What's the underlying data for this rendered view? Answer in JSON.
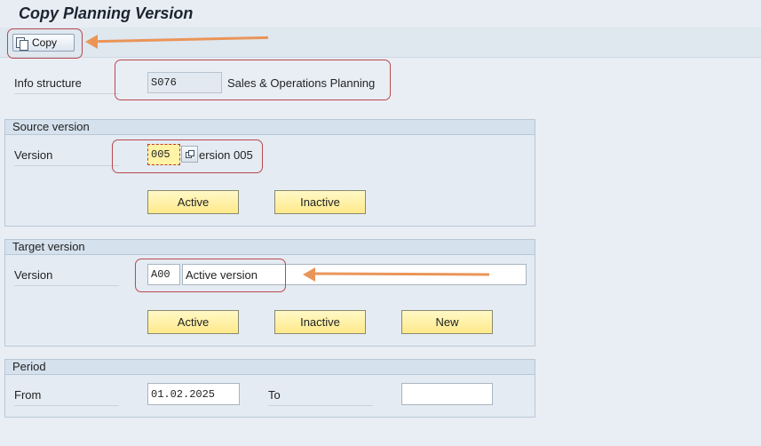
{
  "window": {
    "title": "Copy Planning Version"
  },
  "toolbar": {
    "copy_label": "Copy"
  },
  "info_structure": {
    "label": "Info structure",
    "value": "S076",
    "description": "Sales & Operations Planning"
  },
  "source_version": {
    "group_title": "Source version",
    "label": "Version",
    "value": "005",
    "description": "ersion 005",
    "buttons": {
      "active": "Active",
      "inactive": "Inactive"
    }
  },
  "target_version": {
    "group_title": "Target version",
    "label": "Version",
    "value": "A00",
    "description": "Active version",
    "buttons": {
      "active": "Active",
      "inactive": "Inactive",
      "new": "New"
    }
  },
  "period": {
    "group_title": "Period",
    "from_label": "From",
    "from_value": "01.02.2025",
    "to_label": "To",
    "to_value": ""
  },
  "colors": {
    "annotation_box": "#b9494f",
    "annotation_arrow": "#ea9558",
    "button_yellow": "#ffe98b"
  }
}
